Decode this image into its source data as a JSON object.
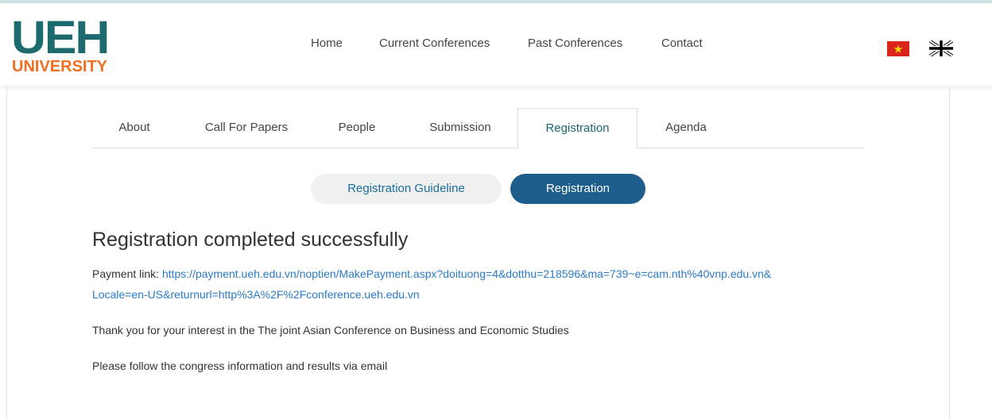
{
  "logo": {
    "top_text": "UEH",
    "bottom_text": "UNIVERSITY"
  },
  "nav": {
    "items": [
      "Home",
      "Current Conferences",
      "Past Conferences",
      "Contact"
    ]
  },
  "languages": [
    {
      "name": "Vietnamese flag"
    },
    {
      "name": "English flag"
    }
  ],
  "tabs": [
    "About",
    "Call For Papers",
    "People",
    "Submission",
    "Registration",
    "Agenda"
  ],
  "active_tab": "Registration",
  "subnav": {
    "guideline_label": "Registration Guideline",
    "registration_label": "Registration"
  },
  "result": {
    "title": "Registration completed successfully",
    "payment_label": "Payment link: ",
    "payment_url_line1": "https://payment.ueh.edu.vn/noptien/MakePayment.aspx?doituong=4&dotthu=218596&ma=739~e=cam.nth%40vnp.edu.vn&",
    "payment_url_line2": "Locale=en-US&returnurl=http%3A%2F%2Fconference.ueh.edu.vn",
    "thanks": "Thank you for your interest in the The joint Asian Conference on Business and Economic Studies",
    "follow": "Please follow the congress information and results via email"
  },
  "colors": {
    "brand_teal": "#1d6b6e",
    "brand_orange": "#f26f21",
    "link_blue": "#2b7bcb",
    "active_pill": "#1e5e8c"
  }
}
